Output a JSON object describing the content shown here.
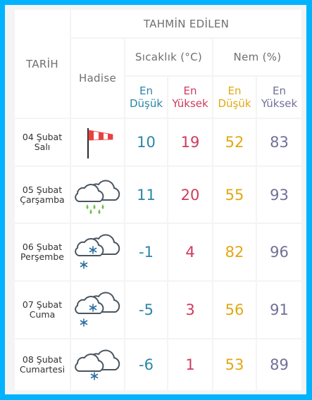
{
  "header": {
    "forecast_title": "TAHMİN EDİLEN",
    "date_col": "TARİH",
    "event_col": "Hadise",
    "temp_group": "Sıcaklık (°C)",
    "humidity_group": "Nem (%)",
    "temp_low": [
      "En",
      "Düşük"
    ],
    "temp_high": [
      "En",
      "Yüksek"
    ],
    "hum_low": [
      "En",
      "Düşük"
    ],
    "hum_high": [
      "En",
      "Yüksek"
    ]
  },
  "colors": {
    "background": "#00b3ff",
    "temp_low": "#2a86a8",
    "temp_high": "#d03a5d",
    "hum_low": "#e0a812",
    "hum_high": "#707099"
  },
  "rows": [
    {
      "date": "04 Şubat",
      "day": "Salı",
      "icon": "windsock-icon",
      "temp_low": "10",
      "temp_high": "19",
      "hum_low": "52",
      "hum_high": "83"
    },
    {
      "date": "05 Şubat",
      "day": "Çarşamba",
      "icon": "rain-cloud-icon",
      "temp_low": "11",
      "temp_high": "20",
      "hum_low": "55",
      "hum_high": "93"
    },
    {
      "date": "06 Şubat",
      "day": "Perşembe",
      "icon": "snow-cloud-icon",
      "temp_low": "-1",
      "temp_high": "4",
      "hum_low": "82",
      "hum_high": "96"
    },
    {
      "date": "07 Şubat",
      "day": "Cuma",
      "icon": "snow-cloud-icon",
      "temp_low": "-5",
      "temp_high": "3",
      "hum_low": "56",
      "hum_high": "91"
    },
    {
      "date": "08 Şubat",
      "day": "Cumartesi",
      "icon": "light-snow-cloud-icon",
      "temp_low": "-6",
      "temp_high": "1",
      "hum_low": "53",
      "hum_high": "89"
    }
  ]
}
